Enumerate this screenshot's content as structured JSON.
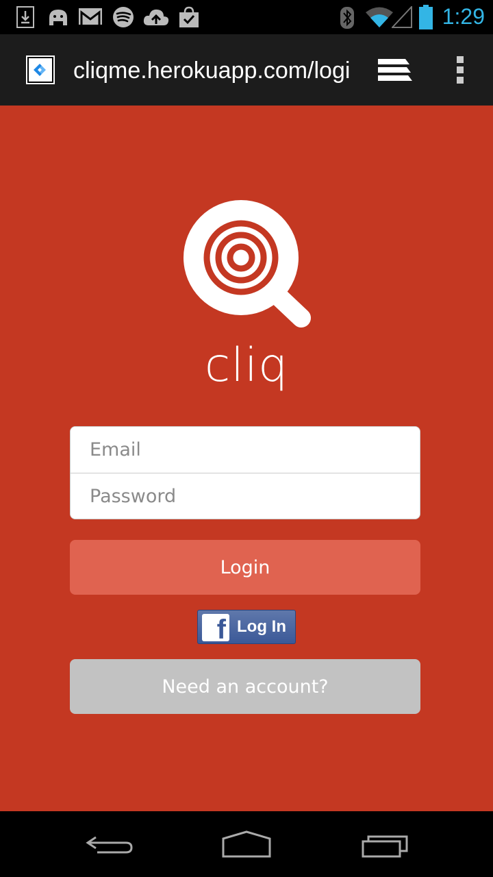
{
  "status_bar": {
    "time": "1:29",
    "icons": [
      "download-icon",
      "android-icon",
      "gmail-icon",
      "spotify-icon",
      "cloud-upload-icon",
      "shopping-bag-icon",
      "bluetooth-icon",
      "wifi-icon",
      "signal-icon",
      "battery-icon"
    ]
  },
  "browser": {
    "url": "cliqme.herokuapp.com/login",
    "icons": [
      "favicon-icon",
      "tabs-icon",
      "overflow-menu-icon"
    ]
  },
  "app": {
    "name": "cliq",
    "email_placeholder": "Email",
    "password_placeholder": "Password",
    "login_label": "Login",
    "facebook_label": "Log In",
    "facebook_glyph": "f",
    "signup_label": "Need an account?"
  },
  "colors": {
    "background": "#c43822",
    "login_button": "#e06350",
    "signup_button": "#c2c2c2",
    "facebook": "#3b5998",
    "clock": "#33b5e5"
  },
  "nav_bar": {
    "icons": [
      "back-icon",
      "home-icon",
      "recent-apps-icon"
    ]
  }
}
